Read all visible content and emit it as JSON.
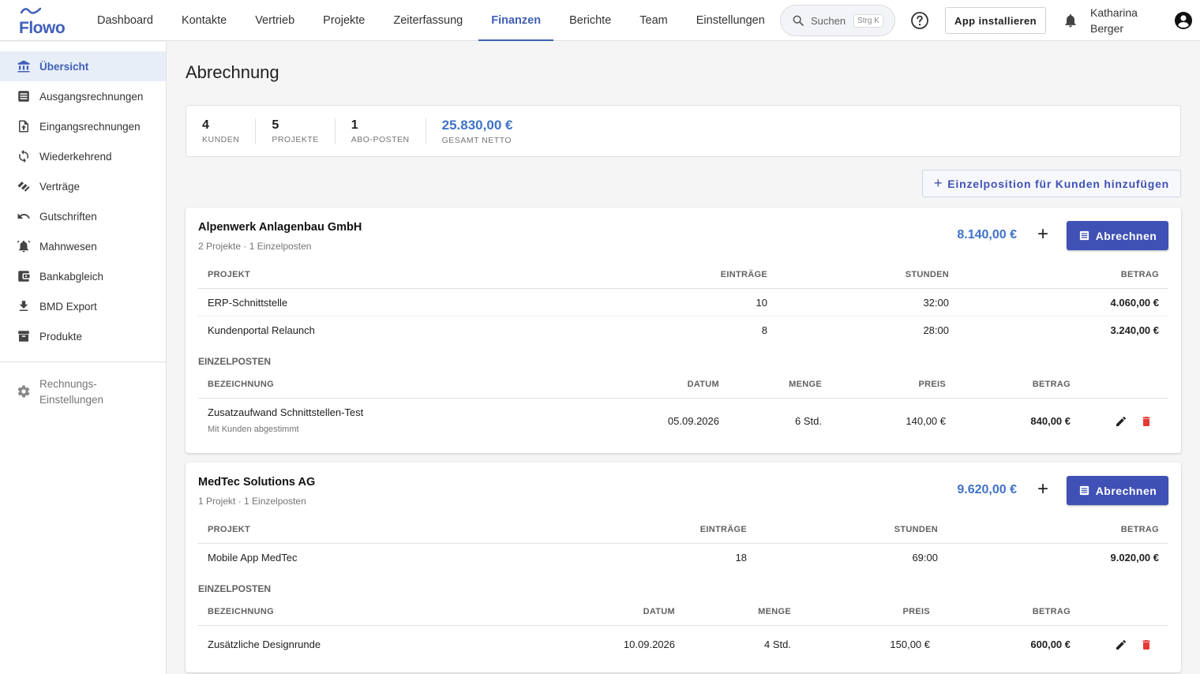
{
  "app": {
    "logo_text": "Flowo",
    "brand_color": "#3f5fb8",
    "accent_color": "#3f51b5",
    "total_color": "#3f72c8",
    "delete_color": "#e53935"
  },
  "nav": {
    "items": [
      {
        "label": "Dashboard"
      },
      {
        "label": "Kontakte"
      },
      {
        "label": "Vertrieb"
      },
      {
        "label": "Projekte"
      },
      {
        "label": "Zeiterfassung"
      },
      {
        "label": "Finanzen",
        "active": true
      },
      {
        "label": "Berichte"
      },
      {
        "label": "Team"
      },
      {
        "label": "Einstellungen"
      }
    ],
    "search_label": "Suchen",
    "search_shortcut": "Strg K",
    "install_label": "App installieren",
    "user_name": "Katharina Berger"
  },
  "sidebar": {
    "items": [
      {
        "label": "Übersicht",
        "icon": "bank-icon",
        "active": true
      },
      {
        "label": "Ausgangsrechnungen",
        "icon": "list-icon"
      },
      {
        "label": "Eingangsrechnungen",
        "icon": "file-upload-icon"
      },
      {
        "label": "Wiederkehrend",
        "icon": "sync-icon"
      },
      {
        "label": "Verträge",
        "icon": "handshake-icon"
      },
      {
        "label": "Gutschriften",
        "icon": "undo-icon"
      },
      {
        "label": "Mahnwesen",
        "icon": "alarm-bell-icon"
      },
      {
        "label": "Bankabgleich",
        "icon": "wallet-icon"
      },
      {
        "label": "BMD Export",
        "icon": "download-icon"
      },
      {
        "label": "Produkte",
        "icon": "archive-icon"
      }
    ],
    "settings_label": "Rechnungs-Einstellungen"
  },
  "page": {
    "title": "Abrechnung",
    "stats": [
      {
        "value": "4",
        "label": "KUNDEN"
      },
      {
        "value": "5",
        "label": "PROJEKTE"
      },
      {
        "value": "1",
        "label": "ABO-POSTEN"
      },
      {
        "value": "25.830,00 €",
        "label": "GESAMT NETTO"
      }
    ],
    "add_item_label": "Einzelposition für Kunden hinzufügen"
  },
  "customers": [
    {
      "name": "Alpenwerk Anlagenbau GmbH",
      "summary": "2 Projekte · 1 Einzelposten",
      "total": "8.140,00 €",
      "bill_label": "Abrechnen",
      "project_headers": {
        "project": "PROJEKT",
        "entries": "EINTRÄGE",
        "hours": "STUNDEN",
        "amount": "BETRAG"
      },
      "projects": [
        {
          "name": "ERP-Schnittstelle",
          "entries": "10",
          "hours": "32:00",
          "amount": "4.060,00 €"
        },
        {
          "name": "Kundenportal Relaunch",
          "entries": "8",
          "hours": "28:00",
          "amount": "3.240,00 €"
        }
      ],
      "items_label": "EINZELPOSTEN",
      "item_headers": {
        "desc": "BEZEICHNUNG",
        "date": "DATUM",
        "qty": "MENGE",
        "price": "PREIS",
        "amount": "BETRAG"
      },
      "items": [
        {
          "desc": "Zusatzaufwand Schnittstellen-Test",
          "note": "Mit Kunden abgestimmt",
          "date": "05.09.2026",
          "qty": "6 Std.",
          "price": "140,00 €",
          "amount": "840,00 €"
        }
      ]
    },
    {
      "name": "MedTec Solutions AG",
      "summary": "1 Projekt · 1 Einzelposten",
      "total": "9.620,00 €",
      "bill_label": "Abrechnen",
      "project_headers": {
        "project": "PROJEKT",
        "entries": "EINTRÄGE",
        "hours": "STUNDEN",
        "amount": "BETRAG"
      },
      "projects": [
        {
          "name": "Mobile App MedTec",
          "entries": "18",
          "hours": "69:00",
          "amount": "9.020,00 €"
        }
      ],
      "items_label": "EINZELPOSTEN",
      "item_headers": {
        "desc": "BEZEICHNUNG",
        "date": "DATUM",
        "qty": "MENGE",
        "price": "PREIS",
        "amount": "BETRAG"
      },
      "items": [
        {
          "desc": "Zusätzliche Designrunde",
          "note": "",
          "date": "10.09.2026",
          "qty": "4 Std.",
          "price": "150,00 €",
          "amount": "600,00 €"
        }
      ]
    }
  ]
}
